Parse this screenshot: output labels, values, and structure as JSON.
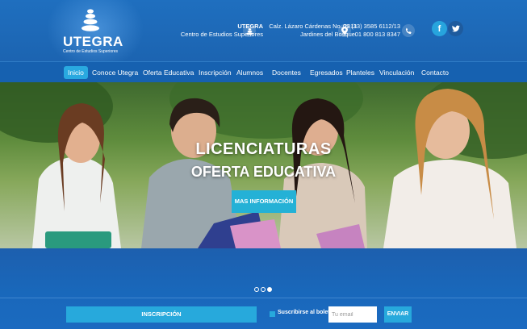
{
  "brand": {
    "logo_text": "UTEGRA",
    "logo_sub": "Centro de Estudios Superiores"
  },
  "header": {
    "name": "UTEGRA",
    "subtitle": "Centro de Estudios Superiores",
    "address_line1": "Calz. Lázaro Cárdenas No. 2811",
    "address_line2": "Jardines del Bosque.",
    "phone_line1": "01 (33) 3585 6112/13",
    "phone_line2": "01 800 813 8347",
    "social": {
      "facebook": "f",
      "twitter": "t"
    }
  },
  "nav": {
    "items": [
      {
        "label": "Inicio",
        "active": true
      },
      {
        "label": "Conoce Utegra"
      },
      {
        "label": "Oferta Educativa"
      },
      {
        "label": "Inscripción"
      },
      {
        "label": "Alumnos"
      },
      {
        "label": "Docentes"
      },
      {
        "label": "Egresados"
      },
      {
        "label": "Planteles"
      },
      {
        "label": "Vinculación"
      },
      {
        "label": "Contacto"
      }
    ]
  },
  "hero": {
    "title_line1": "LICENCIATURAS",
    "title_line2": "OFERTA EDUCATIVA",
    "button": "MAS INFORMACIÓN",
    "slides_total": 3,
    "active_slide": 3
  },
  "footer": {
    "inscripcion_button": "INSCRIPCIÓN",
    "subscribe_label": "Suscribirse al boletín",
    "email_placeholder": "Tu email",
    "send_button": "ENVIAR"
  },
  "colors": {
    "primary": "#1c64b1",
    "accent": "#27a9dc",
    "nav": "#1661b0"
  }
}
